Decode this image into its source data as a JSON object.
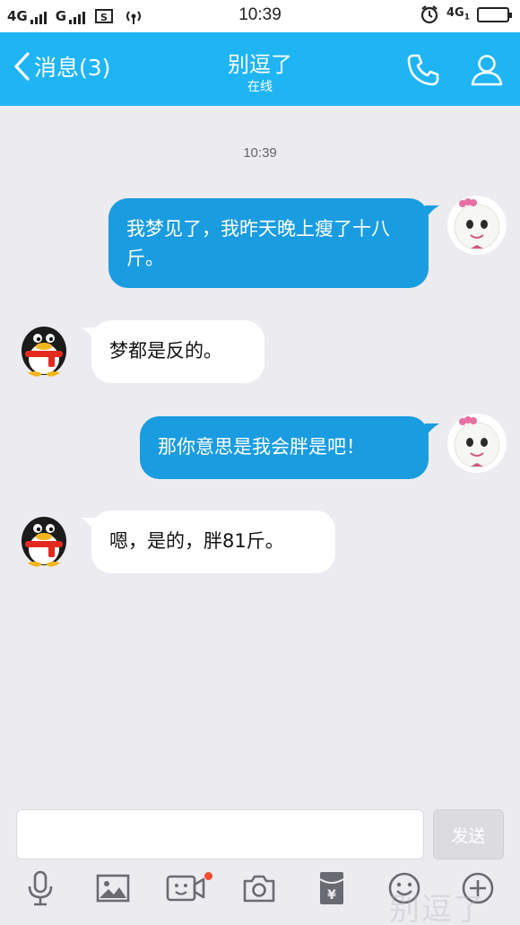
{
  "status_bar": {
    "network1": "4G",
    "network2": "G",
    "time": "10:39",
    "network_right": "4G",
    "network_right_sub": "1"
  },
  "header": {
    "back_label": "消息(3)",
    "title": "别逗了",
    "subtitle": "在线"
  },
  "chat": {
    "timestamp": "10:39",
    "messages": [
      {
        "side": "out",
        "text": "我梦见了，我昨天晚上瘦了十八斤。"
      },
      {
        "side": "in",
        "text": "梦都是反的。"
      },
      {
        "side": "out",
        "text": "那你意思是我会胖是吧！"
      },
      {
        "side": "in",
        "text": "嗯，是的，胖81斤。"
      }
    ]
  },
  "input": {
    "value": "",
    "send_label": "发送"
  },
  "toolbar": {
    "items": [
      "microphone-icon",
      "image-icon",
      "video-call-icon",
      "camera-icon",
      "red-packet-icon",
      "emoji-icon",
      "plus-icon"
    ],
    "red_packet_glyph": "¥"
  },
  "watermark": "别逗了",
  "colors": {
    "accent": "#1fb5f5",
    "bubble_out": "#1a9ce0",
    "bubble_in": "#ffffff",
    "background": "#ebebf0",
    "badge": "#f74c31"
  }
}
